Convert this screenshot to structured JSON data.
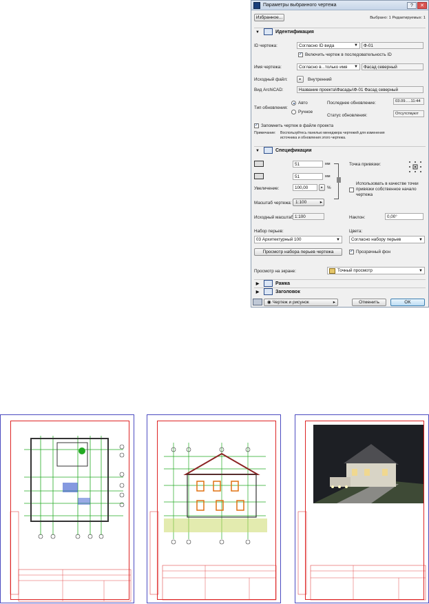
{
  "dialog": {
    "title": "Параметры выбранного чертежа",
    "window_buttons": [
      "?",
      "✕"
    ],
    "favorites_button": "Избранное...",
    "selection_status": "Выбрано: 1 Редактируемых: 1",
    "identification": {
      "header": "Идентификация",
      "drawing_id_label": "ID чертежа:",
      "drawing_id_combo": "Согласно ID вида",
      "drawing_id_value": "Ф-01",
      "include_label": "Включить чертеж в последовательность ID",
      "drawing_name_label": "Имя чертежа:",
      "drawing_name_combo": "Согласно в...только имя",
      "drawing_name_value": "Фасад северный",
      "source_file_label": "Исходный файл:",
      "source_file_value": "Внутренний",
      "view_label": "Вид ArchiCAD:",
      "view_value": "Название проекта\\Фасады\\Ф-01 Фасад северный",
      "update_type_label": "Тип обновления:",
      "auto_label": "Авто",
      "manual_label": "Ручное",
      "last_update_label": "Последнее обновление:",
      "last_update_value": "03.09.....11:44",
      "update_status_label": "Статус обновления:",
      "update_status_value": "Отсутствуют",
      "store_label": "Запомнить чертеж в файле проекта",
      "note_label": "Примечание:",
      "note_text_1": "Воспользуйтесь панелью менеджера чертежей для изменения",
      "note_text_2": "источника и обновления этого чертежа."
    },
    "specifications": {
      "header": "Спецификации",
      "width_value": "51",
      "height_value": "51",
      "unit": "мм",
      "anchor_label": "Точка привязки:",
      "magnification_label": "Увеличение:",
      "magnification_value": "100,00",
      "percent": "%",
      "use_origin_label_1": "Использовать в качестве точки",
      "use_origin_label_2": "привязки собственное начало",
      "use_origin_label_3": "чертежа",
      "drawing_scale_label": "Масштаб чертежа:",
      "drawing_scale_value": "1:100",
      "original_scale_label": "Исходный масштаб:",
      "original_scale_value": "1:100",
      "angle_label": "Наклон:",
      "angle_value": "0,00°",
      "pen_set_label": "Набор перьев:",
      "pen_set_value": "03 Архитектурный 100",
      "colors_label": "Цвета:",
      "colors_value": "Согласно набору перьев",
      "preview_pen_button": "Просмотр набора перьев чертежа",
      "transparent_label": "Прозрачный фон",
      "screen_preview_label": "Просмотр на экране:",
      "screen_preview_value": "Точный просмотр"
    },
    "frame_header": "Рамка",
    "title_header": "Заголовок",
    "footer_combo": "Чертеж и рисунок",
    "cancel_button": "Отменить",
    "ok_button": "OK",
    "accent": "#1a3f7a"
  },
  "sheets": {
    "frame_color": "#dd2222",
    "border_color": "#4a4ac0",
    "grid_color": "#22aa22"
  }
}
